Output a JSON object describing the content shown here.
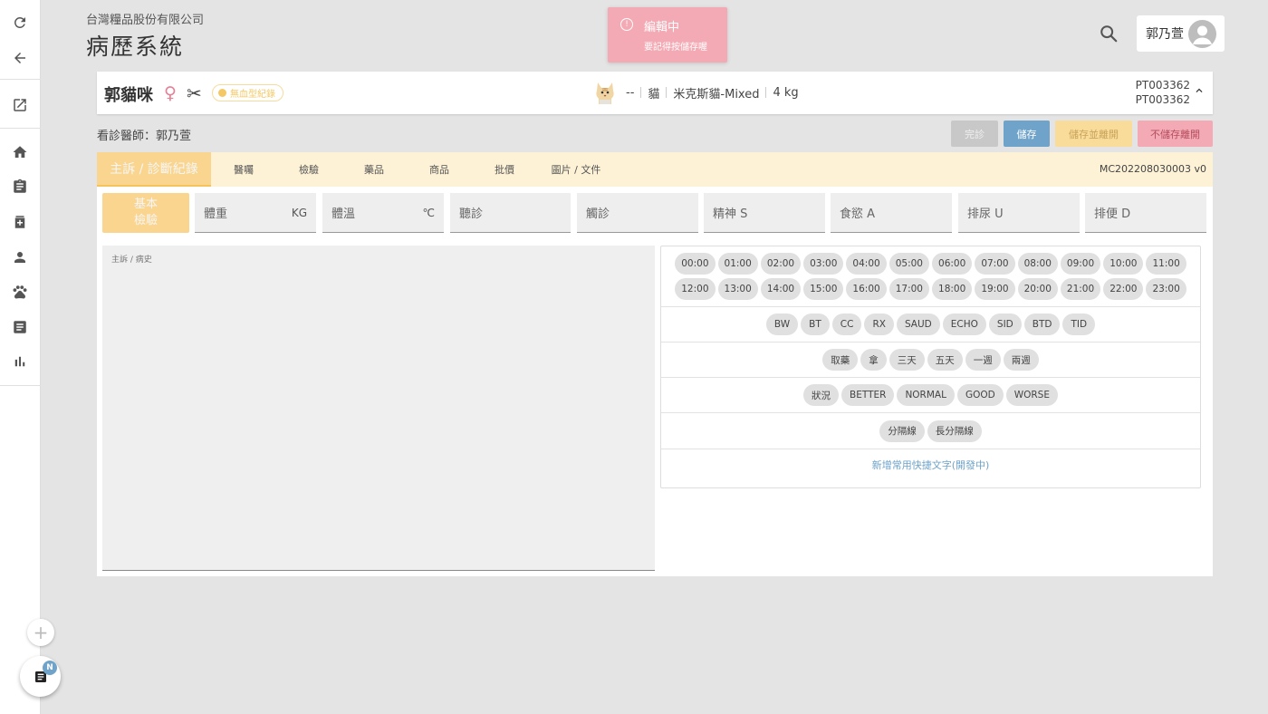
{
  "header": {
    "company": "台灣糧品股份有限公司",
    "system_name": "病歷系統",
    "user_name": "郭乃萱"
  },
  "toast": {
    "title": "編輯中",
    "message": "要記得按儲存喔",
    "icon": "alert-circle-icon",
    "color": "#f3aab4"
  },
  "patient": {
    "name": "郭貓咪",
    "sex_symbol": "♀",
    "blood_badge": "無血型紀錄",
    "info": [
      "--",
      "貓",
      "米克斯貓-Mixed",
      "4 kg"
    ],
    "ids": [
      "PT003362",
      "PT003362"
    ]
  },
  "vet_line": "看診醫師：郭乃萱",
  "actions": {
    "done": "完診",
    "save": "儲存",
    "save_leave": "儲存並離開",
    "leave_without_save": "不儲存離開"
  },
  "tabs": [
    {
      "label": "主訴 / 診斷紀錄",
      "active": true
    },
    {
      "label": "醫囑"
    },
    {
      "label": "檢驗"
    },
    {
      "label": "藥品"
    },
    {
      "label": "商品"
    },
    {
      "label": "批價"
    },
    {
      "label": "圖片 / 文件"
    }
  ],
  "record_id": "MC202208030003 v0",
  "basic_exam": {
    "label_line1": "基本",
    "label_line2": "檢驗",
    "fields": [
      {
        "label": "體重",
        "unit": "KG"
      },
      {
        "label": "體溫",
        "unit": "℃"
      },
      {
        "label": "聽診",
        "unit": ""
      },
      {
        "label": "觸診",
        "unit": ""
      },
      {
        "label": "精神 S",
        "unit": ""
      },
      {
        "label": "食慾 A",
        "unit": ""
      },
      {
        "label": "排尿 U",
        "unit": ""
      },
      {
        "label": "排便 D",
        "unit": ""
      }
    ]
  },
  "history": {
    "label": "主訴 / 病史"
  },
  "quick": {
    "times": [
      "00:00",
      "01:00",
      "02:00",
      "03:00",
      "04:00",
      "05:00",
      "06:00",
      "07:00",
      "08:00",
      "09:00",
      "10:00",
      "11:00",
      "12:00",
      "13:00",
      "14:00",
      "15:00",
      "16:00",
      "17:00",
      "18:00",
      "19:00",
      "20:00",
      "21:00",
      "22:00",
      "23:00"
    ],
    "abbrev": [
      "BW",
      "BT",
      "CC",
      "RX",
      "SAUD",
      "ECHO",
      "SID",
      "BTD",
      "TID"
    ],
    "actions": [
      "取藥",
      "拿",
      "三天",
      "五天",
      "一週",
      "兩週"
    ],
    "status": [
      "狀況",
      "BETTER",
      "NORMAL",
      "GOOD",
      "WORSE"
    ],
    "dividers": [
      "分隔線",
      "長分隔線"
    ],
    "add_label": "新增常用快捷文字(開發中)"
  },
  "notes_badge": "N",
  "colors": {
    "accent_yellow": "#fad58f",
    "save_blue": "#6fa3c9",
    "pink": "#f3aab4"
  }
}
